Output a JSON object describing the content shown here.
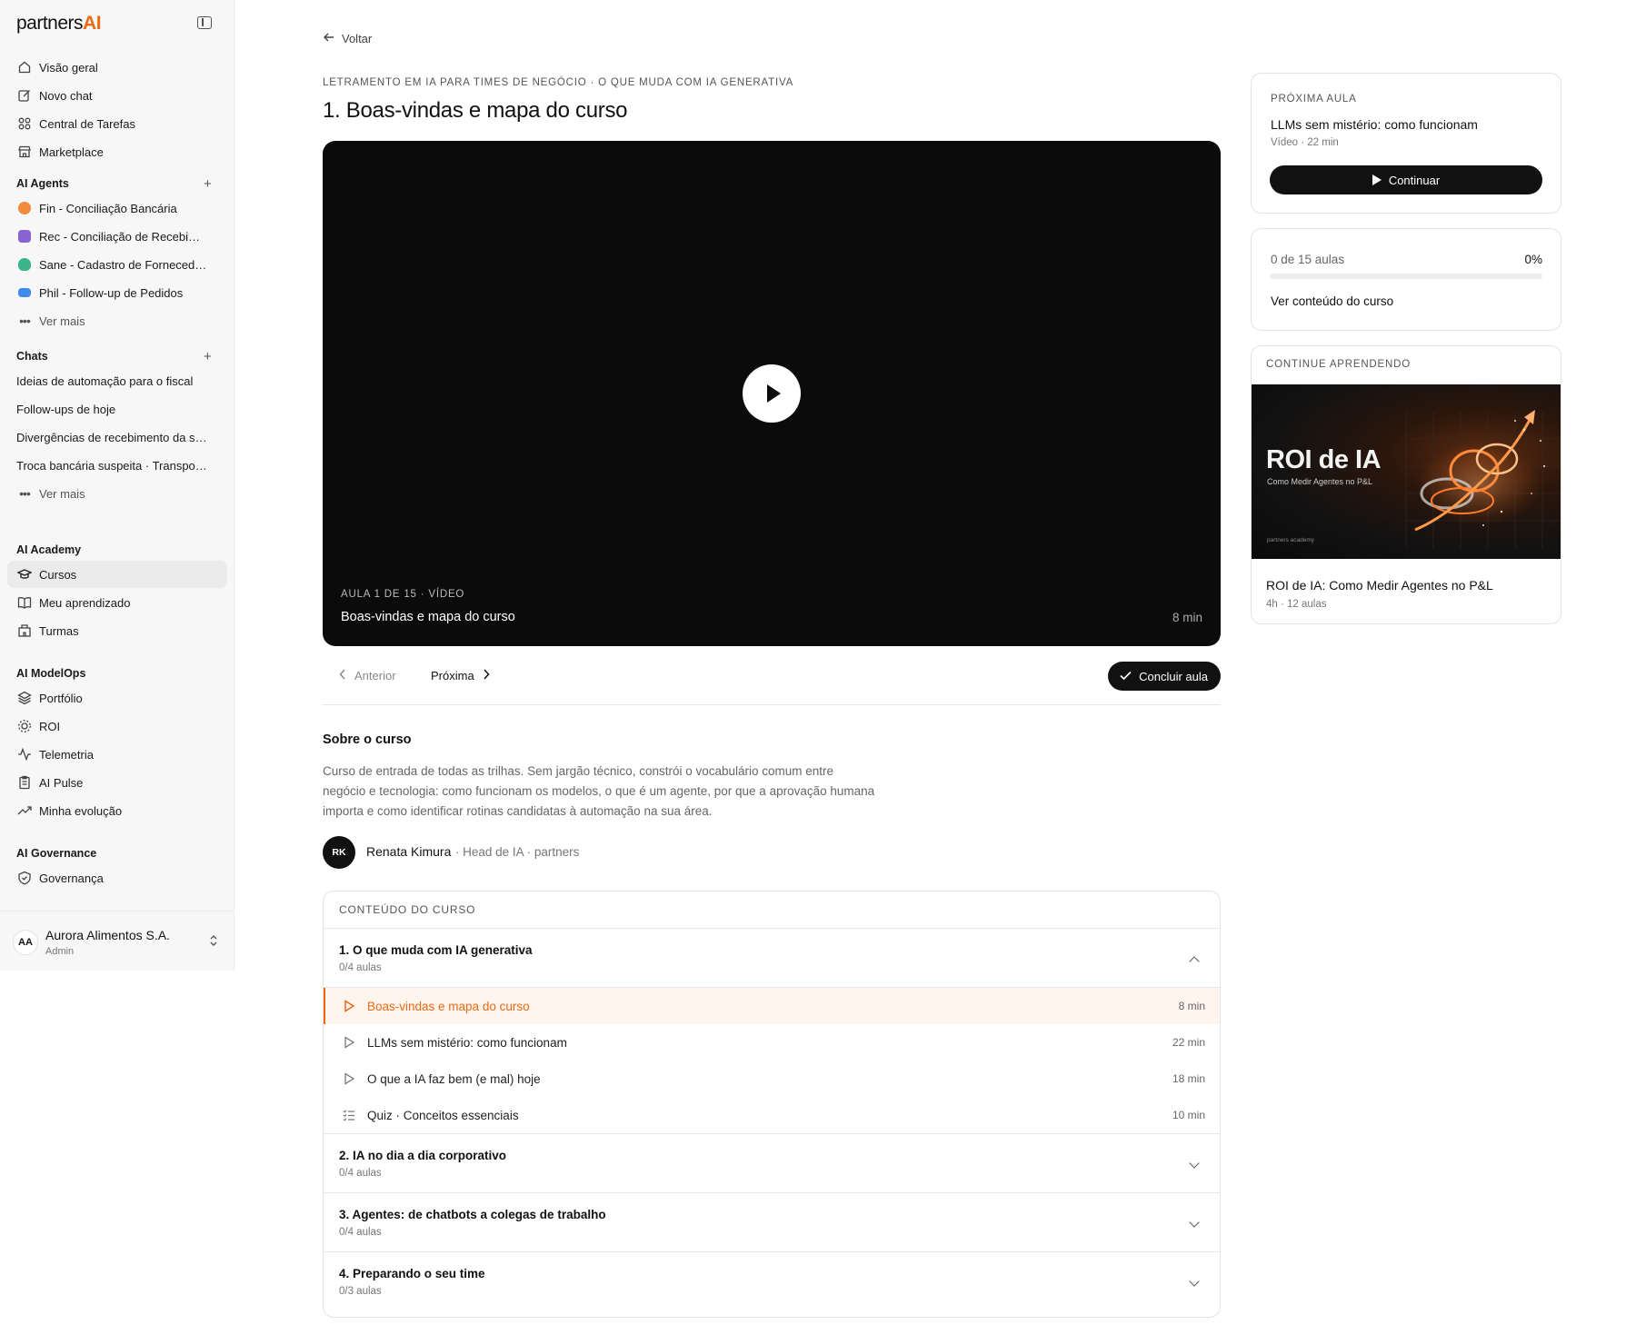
{
  "app": {
    "logo_main": "partners",
    "logo_accent": "AI"
  },
  "sidebar": {
    "top_items": [
      {
        "label": "Visão geral",
        "icon": "home-icon"
      },
      {
        "label": "Novo chat",
        "icon": "edit-icon"
      },
      {
        "label": "Central de Tarefas",
        "icon": "grid-icon"
      },
      {
        "label": "Marketplace",
        "icon": "store-icon"
      }
    ],
    "agents": {
      "title": "AI Agents",
      "items": [
        {
          "label": "Fin - Conciliação Bancária",
          "color": "#f08a3c"
        },
        {
          "label": "Rec - Conciliação de Recebimentos",
          "color": "#8a63d2"
        },
        {
          "label": "Sane - Cadastro de Fornecedores",
          "color": "#3bb58a"
        },
        {
          "label": "Phil - Follow-up de Pedidos",
          "color": "#3d8bea"
        }
      ],
      "more": "Ver mais"
    },
    "chats": {
      "title": "Chats",
      "items": [
        {
          "label": "Ideias de automação para o fiscal"
        },
        {
          "label": "Follow-ups de hoje"
        },
        {
          "label": "Divergências de recebimento da semana"
        },
        {
          "label": "Troca bancária suspeita · Transportadora"
        }
      ],
      "more": "Ver mais"
    },
    "academy": {
      "title": "AI Academy",
      "items": [
        {
          "label": "Cursos",
          "icon": "graduation-cap-icon"
        },
        {
          "label": "Meu aprendizado",
          "icon": "book-icon"
        },
        {
          "label": "Turmas",
          "icon": "building-icon"
        }
      ]
    },
    "modelops": {
      "title": "AI ModelOps",
      "items": [
        {
          "label": "Portfólio",
          "icon": "layers-icon"
        },
        {
          "label": "ROI",
          "icon": "roi-icon"
        },
        {
          "label": "Telemetria",
          "icon": "activity-icon"
        },
        {
          "label": "AI Pulse",
          "icon": "clipboard-icon"
        },
        {
          "label": "Minha evolução",
          "icon": "trending-up-icon"
        }
      ]
    },
    "governance": {
      "title": "AI Governance",
      "items": [
        {
          "label": "Governança",
          "icon": "shield-icon"
        }
      ]
    },
    "account": {
      "initials": "AA",
      "name": "Aurora Alimentos S.A.",
      "role": "Admin"
    }
  },
  "main": {
    "back": "Voltar",
    "breadcrumb": "LETRAMENTO EM IA PARA TIMES DE NEGÓCIO · O QUE MUDA COM IA GENERATIVA",
    "title": "1. Boas-vindas e mapa do curso",
    "video": {
      "meta": "AULA 1 DE 15 · VÍDEO",
      "title": "Boas-vindas e mapa do curso",
      "duration": "8 min"
    },
    "nav": {
      "prev": "Anterior",
      "next": "Próxima",
      "complete": "Concluir aula"
    },
    "about": {
      "title": "Sobre o curso",
      "text": "Curso de entrada de todas as trilhas. Sem jargão técnico, constrói o vocabulário comum entre negócio e tecnologia: como funcionam os modelos, o que é um agente, por que a aprovação humana importa e como identificar rotinas candidatas à automação na sua área.",
      "instructor_initials": "RK",
      "instructor_name": "Renata Kimura",
      "instructor_role": "· Head de IA · partners"
    },
    "content": {
      "header": "CONTEÚDO DO CURSO",
      "modules": [
        {
          "title": "1. O que muda com IA generativa",
          "progress": "0/4 aulas",
          "expanded": true,
          "lessons": [
            {
              "title": "Boas-vindas e mapa do curso",
              "duration": "8 min",
              "type": "video",
              "current": true
            },
            {
              "title": "LLMs sem mistério: como funcionam",
              "duration": "22 min",
              "type": "video"
            },
            {
              "title": "O que a IA faz bem (e mal) hoje",
              "duration": "18 min",
              "type": "video"
            },
            {
              "title": "Quiz · Conceitos essenciais",
              "duration": "10 min",
              "type": "quiz"
            }
          ]
        },
        {
          "title": "2. IA no dia a dia corporativo",
          "progress": "0/4 aulas"
        },
        {
          "title": "3. Agentes: de chatbots a colegas de trabalho",
          "progress": "0/4 aulas"
        },
        {
          "title": "4. Preparando o seu time",
          "progress": "0/3 aulas"
        }
      ]
    }
  },
  "right": {
    "next_lesson": {
      "label": "PRÓXIMA AULA",
      "title": "LLMs sem mistério: como funcionam",
      "meta": "Vídeo · 22 min",
      "button": "Continuar"
    },
    "progress": {
      "count": "0 de 15 aulas",
      "percent_label": "0%",
      "fraction": 0,
      "link": "Ver conteúdo do curso"
    },
    "continue": {
      "label": "CONTINUE APRENDENDO",
      "image_title": "ROI de IA",
      "image_subtitle": "Como Medir Agentes no P&L",
      "image_brand": "partners academy",
      "title": "ROI de IA: Como Medir Agentes no P&L",
      "meta": "4h · 12 aulas"
    }
  },
  "colors": {
    "accent": "#ea6a14",
    "dark": "#111111"
  }
}
